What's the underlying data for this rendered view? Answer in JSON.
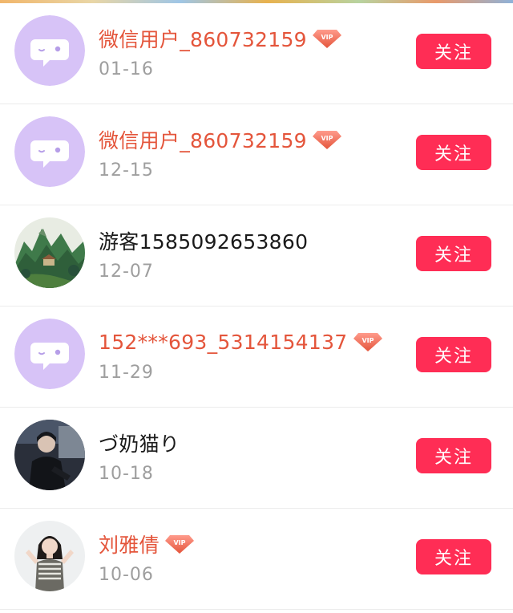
{
  "users": [
    {
      "name": "微信用户_860732159",
      "date": "01-16",
      "vip": true,
      "avatar": "default-chat-avatar",
      "follow_label": "关注"
    },
    {
      "name": "微信用户_860732159",
      "date": "12-15",
      "vip": true,
      "avatar": "default-chat-avatar",
      "follow_label": "关注"
    },
    {
      "name": "游客1585092653860",
      "date": "12-07",
      "vip": false,
      "avatar": "landscape-painting-avatar",
      "follow_label": "关注"
    },
    {
      "name": "152***693_5314154137",
      "date": "11-29",
      "vip": true,
      "avatar": "default-chat-avatar",
      "follow_label": "关注"
    },
    {
      "name": "づ奶猫り",
      "date": "10-18",
      "vip": false,
      "avatar": "dark-portrait-avatar",
      "follow_label": "关注"
    },
    {
      "name": "刘雅倩",
      "date": "10-06",
      "vip": true,
      "avatar": "woman-portrait-avatar",
      "follow_label": "关注"
    }
  ],
  "badge_text": "VIP",
  "colors": {
    "vip_name": "#e4553b",
    "normal_name": "#1a1a1a",
    "follow_button": "#ff2d55",
    "date": "#9e9e9e",
    "default_avatar": "#d7c3f7"
  }
}
